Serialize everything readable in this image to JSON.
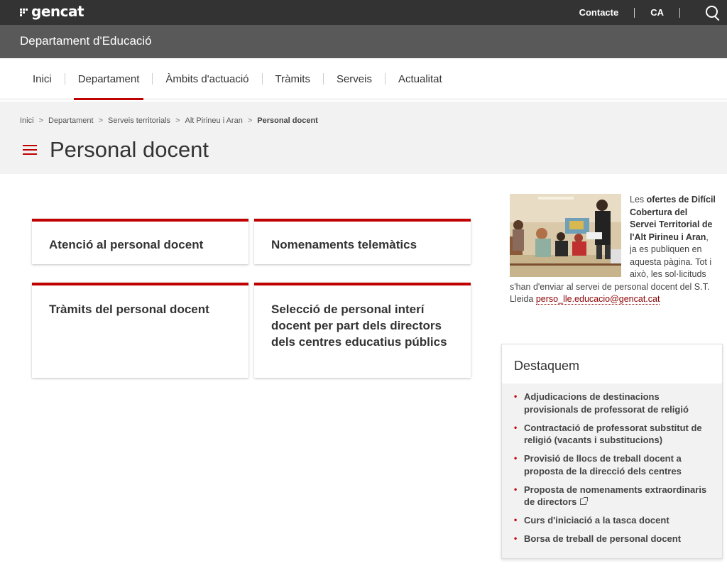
{
  "topbar": {
    "logo": "gencat",
    "contact": "Contacte",
    "language": "CA"
  },
  "department": {
    "title": "Departament d'Educació"
  },
  "nav": {
    "items": [
      "Inici",
      "Departament",
      "Àmbits d'actuació",
      "Tràmits",
      "Serveis",
      "Actualitat"
    ],
    "active": "Departament"
  },
  "breadcrumb": [
    "Inici",
    "Departament",
    "Serveis territorials",
    "Alt Pirineu i Aran",
    "Personal docent"
  ],
  "page": {
    "title": "Personal docent"
  },
  "cards": [
    {
      "title": "Atenció al personal docent"
    },
    {
      "title": "Nomenaments telemàtics"
    },
    {
      "title": "Tràmits del personal docent"
    },
    {
      "title": "Selecció de personal interí docent per part dels directors dels centres educatius públics"
    }
  ],
  "promo": {
    "t1": "Les ",
    "t2": "ofertes de Difícil Cobertura del Servei Territorial de l'Alt Pirineu i Aran",
    "t3": ", ja es publiquen en aquesta pàgina. Tot i això, les sol·licituds s'han d'enviar al servei de personal docent del S.T. Lleida ",
    "email": "perso_lle.educacio@gencat.cat"
  },
  "destaquem": {
    "title": "Destaquem",
    "items": [
      "Adjudicacions de destinacions provisionals de professorat de religió",
      "Contractació de professorat substitut de religió (vacants i substitucions)",
      "Provisió de llocs de treball docent a proposta de la direcció dels centres",
      "Proposta de nomenaments extraordinaris de directors",
      "Curs d'iniciació a la tasca docent",
      "Borsa de treball de personal docent"
    ]
  },
  "colors": {
    "accent": "#c00000",
    "topbar": "#333333",
    "deptbar": "#595959"
  }
}
